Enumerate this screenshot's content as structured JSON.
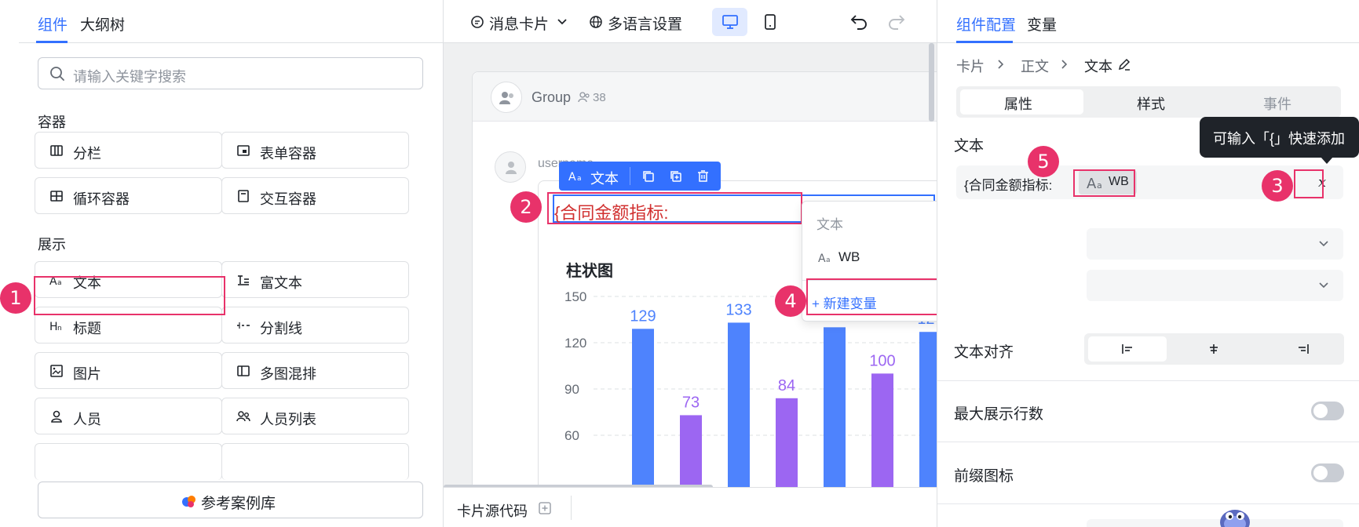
{
  "left_panel": {
    "tabs": [
      "组件",
      "大纲树"
    ],
    "search_placeholder": "请输入关键字搜索",
    "sections": {
      "container": "容器",
      "display": "展示"
    },
    "container_items": [
      "分栏",
      "表单容器",
      "循环容器",
      "交互容器"
    ],
    "display_items": [
      "文本",
      "富文本",
      "标题",
      "分割线",
      "图片",
      "多图混排",
      "人员",
      "人员列表"
    ],
    "case_library": "参考案例库"
  },
  "toolbar": {
    "message_card": "消息卡片",
    "language": "多语言设置"
  },
  "preview": {
    "group_name": "Group",
    "member_count": "38",
    "username": "username",
    "selected_component": "文本",
    "text_content": "{合同金额指标:",
    "chart_title": "柱状图"
  },
  "chart_data": {
    "type": "bar",
    "title": "柱状图",
    "y_ticks": [
      60,
      90,
      120,
      150
    ],
    "ylim": [
      0,
      150
    ],
    "values": [
      129,
      73,
      133,
      84,
      130,
      100,
      127
    ],
    "colors": [
      "#4e83fd",
      "#9c66f2",
      "#4e83fd",
      "#9c66f2",
      "#4e83fd",
      "#9c66f2",
      "#4e83fd"
    ]
  },
  "dropdown": {
    "header": "文本",
    "option": "WB",
    "new_variable": "+ 新建变量"
  },
  "bottom_bar": {
    "source_code": "卡片源代码"
  },
  "right_panel": {
    "tabs": [
      "组件配置",
      "变量"
    ],
    "breadcrumb": [
      "卡片",
      "正文",
      "文本"
    ],
    "segments": [
      "属性",
      "样式",
      "事件"
    ],
    "text_label": "文本",
    "text_value": "{合同金额指标:",
    "variable_chip": "WB",
    "tooltip": "可输入「{」快速添加",
    "align_label": "文本对齐",
    "max_lines_label": "最大展示行数",
    "prefix_icon_label": "前缀图标"
  },
  "annotations": [
    "1",
    "2",
    "3",
    "4",
    "5"
  ],
  "colors": {
    "accent": "#3370ff",
    "highlight": "#e8326a"
  }
}
